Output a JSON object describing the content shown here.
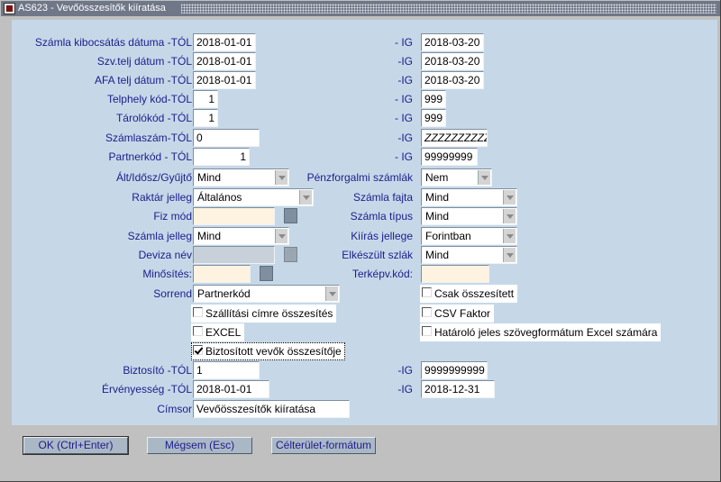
{
  "window": {
    "title": "AS623 - Vevőösszesítők kiíratása"
  },
  "fields": {
    "szamla_kibocsatas": {
      "label": "Számla kibocsátás dátuma -TÓL",
      "from": "2018-01-01",
      "to_label": "- IG",
      "to": "2018-03-20"
    },
    "szvtelj": {
      "label": "Szv.telj dátum -TÓL",
      "from": "2018-01-01",
      "to_label": "-IG",
      "to": "2018-03-20"
    },
    "afatelj": {
      "label": "AFA telj dátum -TÓL",
      "from": "2018-01-01",
      "to_label": "-IG",
      "to": "2018-03-20"
    },
    "telephely": {
      "label": "Telphely kód-TÓL",
      "from": "1",
      "to_label": "- IG",
      "to": "999"
    },
    "tarolokod": {
      "label": "Tárolókód -TÓL",
      "from": "1",
      "to_label": "- IG",
      "to": "999"
    },
    "szamlaszam": {
      "label": "Számlaszám-TÓL",
      "from": "0",
      "to_label": "-IG",
      "to": "ZZZZZZZZZZZ"
    },
    "partnerkod": {
      "label": "Partnerkód - TÓL",
      "from": "1",
      "to_label": "- IG",
      "to": "99999999"
    },
    "alt_idosz": {
      "label": "Ált/Idősz/Gyűjtő",
      "value": "Mind"
    },
    "penzforgalmi": {
      "label": "Pénzforgalmi számlák",
      "value": "Nem"
    },
    "raktar_jelleg": {
      "label": "Raktár jelleg",
      "value": "Általános"
    },
    "szamla_fajta": {
      "label": "Számla fajta",
      "value": "Mind"
    },
    "fiz_mod": {
      "label": "Fiz mód",
      "value": ""
    },
    "szamla_tipus": {
      "label": "Számla típus",
      "value": "Mind"
    },
    "szamla_jelleg": {
      "label": "Számla jelleg",
      "value": "Mind"
    },
    "kiiras_jellege": {
      "label": "Kiírás jellege",
      "value": "Forintban"
    },
    "deviza_nev": {
      "label": "Deviza név",
      "value": ""
    },
    "elkeszult": {
      "label": "Elkészült szlák",
      "value": "Mind"
    },
    "minosites": {
      "label": "Minősítés:",
      "value": ""
    },
    "terkepv": {
      "label": "Terképv.kód:",
      "value": ""
    },
    "sorrend": {
      "label": "Sorrend",
      "value": "Partnerkód"
    },
    "biztosito": {
      "label": "Biztosító -TÓL",
      "from": "1",
      "to_label": "-IG",
      "to": "9999999999"
    },
    "ervenyesseg": {
      "label": "Érvényesség -TÓL",
      "from": "2018-01-01",
      "to_label": "-IG",
      "to": "2018-12-31"
    },
    "cimsor": {
      "label": "Címsor",
      "value": "Vevőösszesítők kiíratása"
    }
  },
  "checkboxes": {
    "szallitasi": {
      "label": "Szállítási címre összesítés",
      "checked": false
    },
    "excel": {
      "label": "EXCEL",
      "checked": false
    },
    "biztositott": {
      "label": "Biztosított vevők összesítője",
      "checked": true
    },
    "csak_osszesitett": {
      "label": "Csak összesített",
      "checked": false
    },
    "csv_faktor": {
      "label": "CSV Faktor",
      "checked": false
    },
    "hatarolo": {
      "label": "Határoló jeles szövegformátum  Excel számára",
      "checked": false
    }
  },
  "buttons": {
    "ok": "OK (Ctrl+Enter)",
    "cancel": "Mégsem (Esc)",
    "target_format": "Célterület-formátum"
  }
}
